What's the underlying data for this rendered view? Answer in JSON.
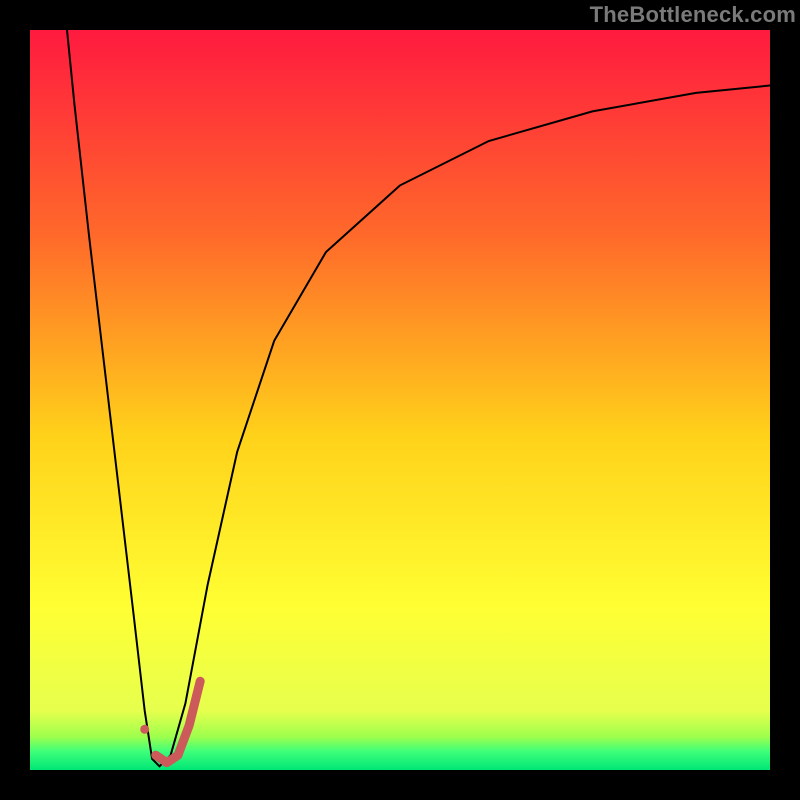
{
  "watermark": "TheBottleneck.com",
  "chart_data": {
    "type": "line",
    "title": "",
    "xlabel": "",
    "ylabel": "",
    "x_range": [
      0,
      100
    ],
    "y_range": [
      0,
      100
    ],
    "grid": false,
    "legend": false,
    "annotations": [],
    "background_gradient_stops": [
      {
        "offset": 0.0,
        "color": "#ff1a3f"
      },
      {
        "offset": 0.28,
        "color": "#ff6a2a"
      },
      {
        "offset": 0.55,
        "color": "#ffd21a"
      },
      {
        "offset": 0.78,
        "color": "#ffff33"
      },
      {
        "offset": 0.92,
        "color": "#e6ff4d"
      },
      {
        "offset": 0.955,
        "color": "#9eff4d"
      },
      {
        "offset": 0.975,
        "color": "#3dff7a"
      },
      {
        "offset": 1.0,
        "color": "#00e676"
      }
    ],
    "series": [
      {
        "name": "bottleneck-curve",
        "stroke": "#000000",
        "stroke_width": 2,
        "points": [
          {
            "x": 5.0,
            "y": 100.0
          },
          {
            "x": 6.0,
            "y": 90.0
          },
          {
            "x": 8.0,
            "y": 72.0
          },
          {
            "x": 10.0,
            "y": 55.0
          },
          {
            "x": 12.0,
            "y": 38.0
          },
          {
            "x": 14.0,
            "y": 21.0
          },
          {
            "x": 15.5,
            "y": 8.0
          },
          {
            "x": 16.5,
            "y": 1.5
          },
          {
            "x": 17.5,
            "y": 0.5
          },
          {
            "x": 19.0,
            "y": 2.0
          },
          {
            "x": 21.0,
            "y": 9.0
          },
          {
            "x": 24.0,
            "y": 25.0
          },
          {
            "x": 28.0,
            "y": 43.0
          },
          {
            "x": 33.0,
            "y": 58.0
          },
          {
            "x": 40.0,
            "y": 70.0
          },
          {
            "x": 50.0,
            "y": 79.0
          },
          {
            "x": 62.0,
            "y": 85.0
          },
          {
            "x": 76.0,
            "y": 89.0
          },
          {
            "x": 90.0,
            "y": 91.5
          },
          {
            "x": 100.0,
            "y": 92.5
          }
        ]
      },
      {
        "name": "highlight-j",
        "stroke": "#cc5a5a",
        "stroke_width": 9,
        "linecap": "round",
        "points": [
          {
            "x": 17.0,
            "y": 2.0
          },
          {
            "x": 18.5,
            "y": 1.0
          },
          {
            "x": 20.0,
            "y": 2.0
          },
          {
            "x": 21.5,
            "y": 6.0
          },
          {
            "x": 23.0,
            "y": 12.0
          }
        ]
      }
    ],
    "markers": [
      {
        "name": "marker-dot",
        "x": 15.5,
        "y": 5.5,
        "r": 4.5,
        "fill": "#cc5a5a"
      }
    ]
  }
}
